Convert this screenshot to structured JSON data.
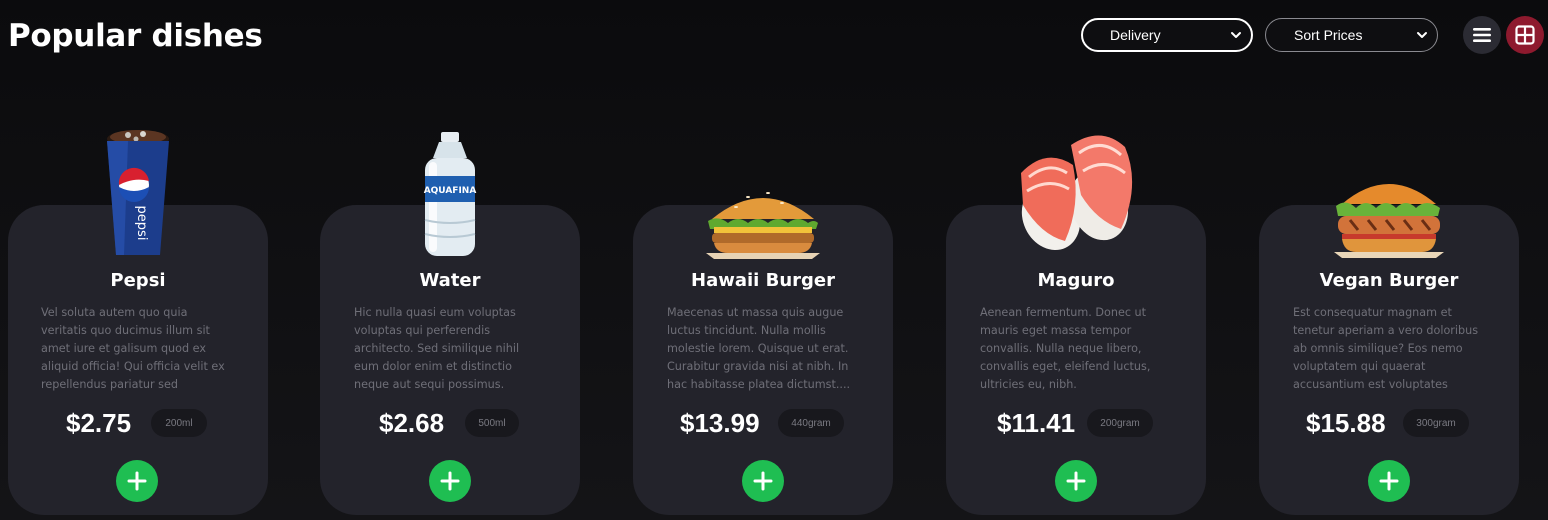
{
  "header": {
    "title": "Popular dishes",
    "delivery_select": {
      "selected": "Delivery"
    },
    "sort_select": {
      "selected": "Sort Prices"
    },
    "view_toggle": {
      "list_icon": "list-icon",
      "grid_icon": "grid-icon",
      "active": "grid"
    }
  },
  "colors": {
    "accent_red": "#8e1a2e",
    "add_green": "#1fbe52",
    "card_bg": "#23232b"
  },
  "dishes": [
    {
      "name": "Pepsi",
      "description": "Vel soluta autem quo quia veritatis quo ducimus illum sit amet iure et galisum quod ex aliquid officia! Qui officia velit ex repellendus pariatur sed repellendus iusto!",
      "price": "$2.75",
      "size": "200ml",
      "image": "pepsi-cup"
    },
    {
      "name": "Water",
      "description": "Hic nulla quasi eum voluptas voluptas qui perferendis architecto. Sed similique nihil eum dolor enim et distinctio neque aut sequi possimus.",
      "price": "$2.68",
      "size": "500ml",
      "image": "aquafina-bottle"
    },
    {
      "name": "Hawaii Burger",
      "description": "Maecenas ut massa quis augue luctus tincidunt. Nulla mollis molestie lorem. Quisque ut erat. Curabitur gravida nisi at nibh. In hac habitasse platea dictumst....",
      "price": "$13.99",
      "size": "440gram",
      "image": "burger"
    },
    {
      "name": "Maguro",
      "description": "Aenean fermentum. Donec ut mauris eget massa tempor convallis. Nulla neque libero, convallis eget, eleifend luctus, ultricies eu, nibh.",
      "price": "$11.41",
      "size": "200gram",
      "image": "tuna-nigiri"
    },
    {
      "name": "Vegan Burger",
      "description": "Est consequatur magnam et tenetur aperiam a vero doloribus ab omnis similique? Eos nemo voluptatem qui quaerat accusantium est voluptates aliqu...",
      "price": "$15.88",
      "size": "300gram",
      "image": "grilled-burger"
    }
  ]
}
